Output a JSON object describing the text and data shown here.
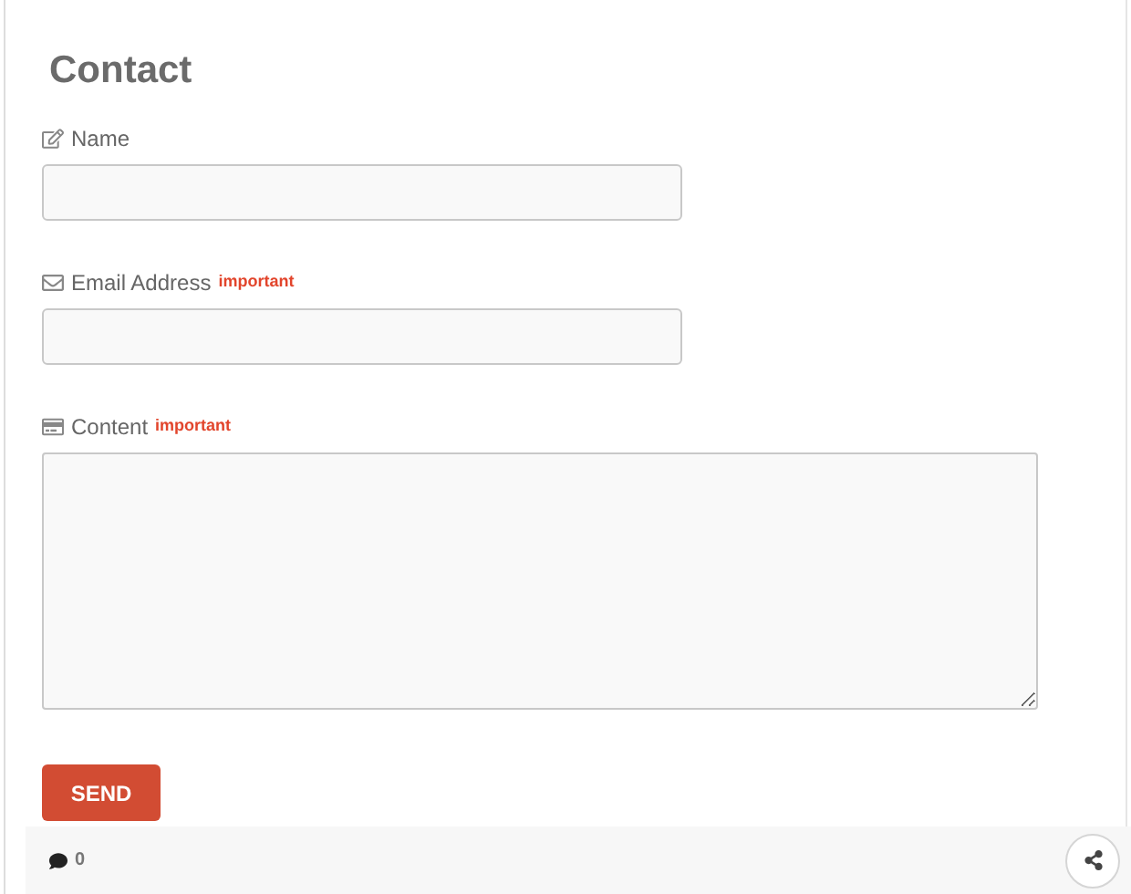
{
  "title": "Contact",
  "fields": [
    {
      "kind": "name",
      "label": "Name"
    },
    {
      "kind": "email",
      "label": "Email Address",
      "badge": "important"
    },
    {
      "kind": "message",
      "label": "Content",
      "badge": "important"
    }
  ],
  "submit": "SEND",
  "footer": {
    "comments": "0"
  }
}
